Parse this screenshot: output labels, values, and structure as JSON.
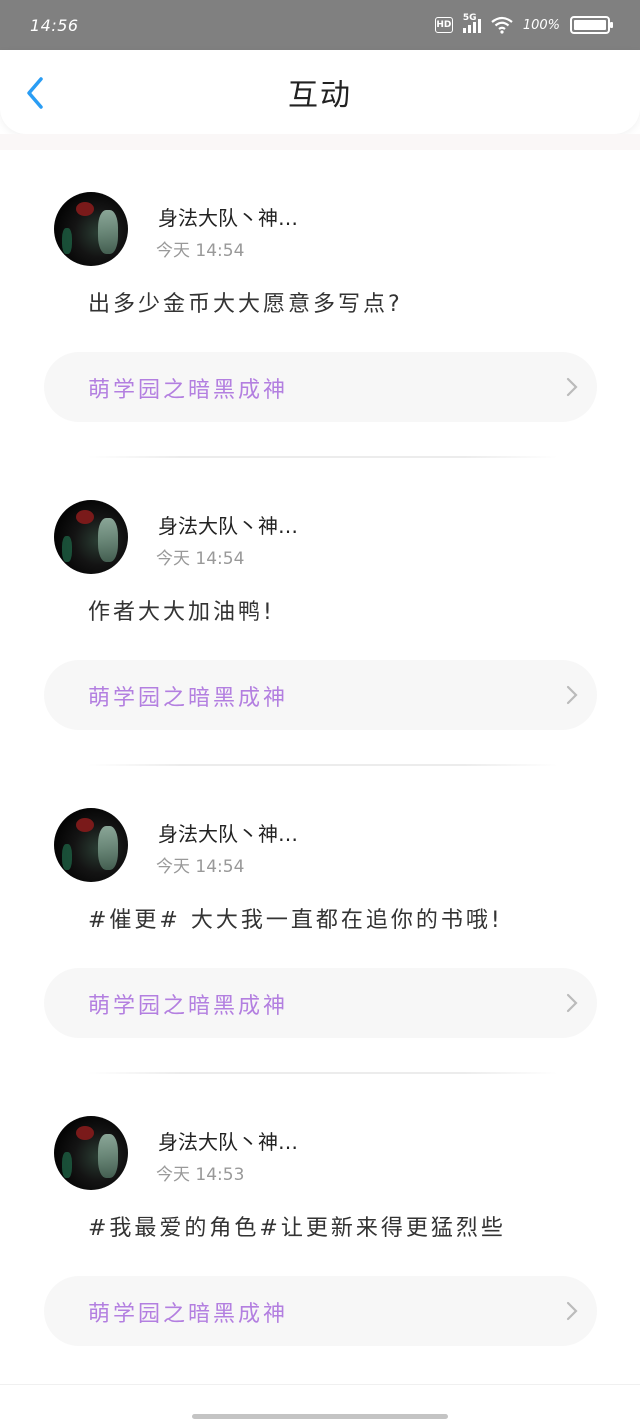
{
  "status_bar": {
    "time": "14:56",
    "network_badge": "HD",
    "network_type": "5G",
    "battery_percent": "100%",
    "battery_level": 1.0
  },
  "header": {
    "title": "互动",
    "back_icon": "chevron-left-icon"
  },
  "comments": [
    {
      "username": "身法大队丶神…",
      "time": "今天 14:54",
      "content": "出多少金币大大愿意多写点?",
      "book": "萌学园之暗黑成神"
    },
    {
      "username": "身法大队丶神…",
      "time": "今天 14:54",
      "content": "作者大大加油鸭!",
      "book": "萌学园之暗黑成神"
    },
    {
      "username": "身法大队丶神…",
      "time": "今天 14:54",
      "content": "#催更# 大大我一直都在追你的书哦!",
      "book": "萌学园之暗黑成神"
    },
    {
      "username": "身法大队丶神…",
      "time": "今天 14:53",
      "content": "#我最爱的角色#让更新来得更猛烈些",
      "book": "萌学园之暗黑成神"
    }
  ],
  "colors": {
    "accent_blue": "#2a9df4",
    "book_purple": "#b37fe0",
    "status_bar": "#808080"
  }
}
